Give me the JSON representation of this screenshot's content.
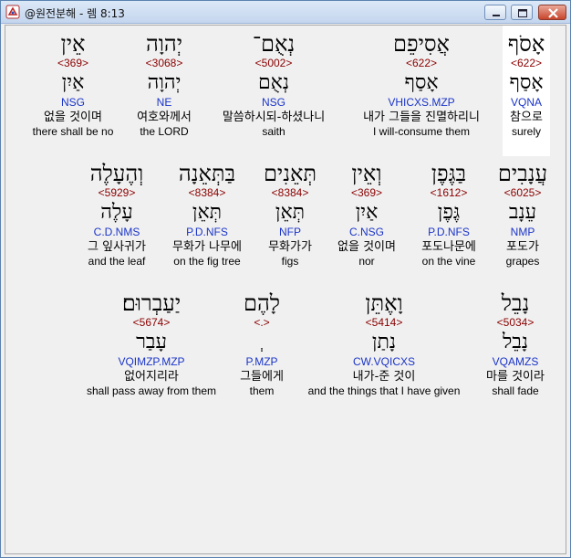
{
  "window": {
    "title": "@원전분해 - 렘 8:13"
  },
  "rows": [
    [
      {
        "heb": "אָסֹף",
        "num": "<622>",
        "lex": "אָסַף",
        "code": "VQNA",
        "kor": "참으로",
        "eng": "surely"
      },
      {
        "heb": "אֲסִיפֵם",
        "num": "<622>",
        "lex": "אָסַף",
        "code": "VHICXS.MZP",
        "kor": "내가 그들을 진멸하리니",
        "eng": "I will-consume them"
      },
      {
        "heb": "נְאֻם־",
        "num": "<5002>",
        "lex": "נְאֻם",
        "code": "NSG",
        "kor": "말씀하시되-하셨나니",
        "eng": "saith"
      },
      {
        "heb": "יְהוָה",
        "num": "<3068>",
        "lex": "יְהוָה",
        "code": "NE",
        "kor": "여호와께서",
        "eng": "the LORD"
      },
      {
        "heb": "אֵין",
        "num": "<369>",
        "lex": "אַיִן",
        "code": "NSG",
        "kor": "없을 것이며",
        "eng": "there shall be no"
      }
    ],
    [
      {
        "heb": "עֲנָבִים",
        "num": "<6025>",
        "lex": "עֵנָב",
        "code": "NMP",
        "kor": "포도가",
        "eng": "grapes"
      },
      {
        "heb": "בַּגֶּפֶן",
        "num": "<1612>",
        "lex": "גֶּפֶן",
        "code": "P.D.NFS",
        "kor": "포도나문에",
        "eng": "on the vine"
      },
      {
        "heb": "וְאֵין",
        "num": "<369>",
        "lex": "אַיִן",
        "code": "C.NSG",
        "kor": "없을 것이며",
        "eng": "nor"
      },
      {
        "heb": "תְּאֵנִים",
        "num": "<8384>",
        "lex": "תְּאֵן",
        "code": "NFP",
        "kor": "무화가가",
        "eng": "figs"
      },
      {
        "heb": "בַּתְּאֵנָה",
        "num": "<8384>",
        "lex": "תְּאֵן",
        "code": "P.D.NFS",
        "kor": "무화가 나무에",
        "eng": "on the fig tree"
      },
      {
        "heb": "וְהֶעָלֶה",
        "num": "<5929>",
        "lex": "עָלֶה",
        "code": "C.D.NMS",
        "kor": "그 잎사귀가",
        "eng": "and the leaf"
      }
    ],
    [
      {
        "heb": "נָבֵל",
        "num": "<5034>",
        "lex": "נָבֵל",
        "code": "VQAMZS",
        "kor": "마를 것이라",
        "eng": "shall fade"
      },
      {
        "heb": "וָאֶתֵּן",
        "num": "<5414>",
        "lex": "נָתַן",
        "code": "CW.VQICXS",
        "kor": "내가-준 것이",
        "eng": "and the things that I have given"
      },
      {
        "heb": "לָהֶם",
        "num": "<.>",
        "lex": "ְ",
        "code": "P.MZP",
        "kor": "그들에게",
        "eng": "them"
      },
      {
        "heb": "יַעַבְרוּם׃",
        "num": "<5674>",
        "lex": "עָבַר",
        "code": "VQIMZP.MZP",
        "kor": "없어지리라",
        "eng": "shall pass away from them"
      }
    ]
  ]
}
